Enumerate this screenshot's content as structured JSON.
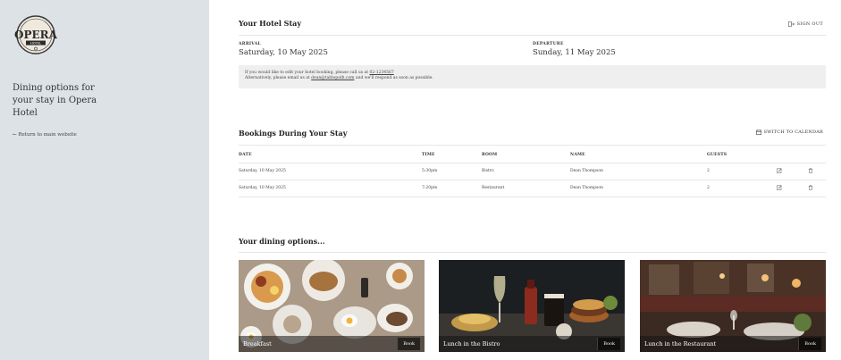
{
  "sidebar": {
    "logo_text": "OPERA",
    "logo_subtext": "HOTEL",
    "heading": "Dining options for your stay in Opera Hotel",
    "return_link": "← Return to main website"
  },
  "stay": {
    "title": "Your Hotel Stay",
    "sign_out": "SIGN OUT",
    "arrival_label": "ARRIVAL",
    "arrival_value": "Saturday, 10 May 2025",
    "departure_label": "DEPARTURE",
    "departure_value": "Sunday, 11 May 2025",
    "notice_line1_pre": "If you would like to edit your hotel booking, please call us at",
    "notice_phone": "02-1234567",
    "notice_line2_pre": "Alternatively, please email us at",
    "notice_email": "dean@tablepath.com",
    "notice_line2_post": "and we'll respond as soon as possible."
  },
  "bookings": {
    "title": "Bookings During Your Stay",
    "switch_label": "SWITCH TO CALENDAR",
    "columns": [
      "DATE",
      "TIME",
      "ROOM",
      "NAME",
      "GUESTS"
    ],
    "rows": [
      {
        "date": "Saturday, 10 May 2025",
        "time": "5:30pm",
        "room": "Bistro",
        "name": "Dean Thompson",
        "guests": "2"
      },
      {
        "date": "Saturday, 10 May 2025",
        "time": "7:20pm",
        "room": "Restaurant",
        "name": "Dean Thompson",
        "guests": "2"
      }
    ]
  },
  "dining": {
    "title": "Your dining options...",
    "cards": [
      {
        "title": "Breakfast",
        "book": "Book"
      },
      {
        "title": "Lunch in the Bistro",
        "book": "Book"
      },
      {
        "title": "Lunch in the Restaurant",
        "book": "Book"
      }
    ]
  },
  "colors": {
    "sidebar_bg": "#dde2e6",
    "notice_bg": "#efefef"
  }
}
